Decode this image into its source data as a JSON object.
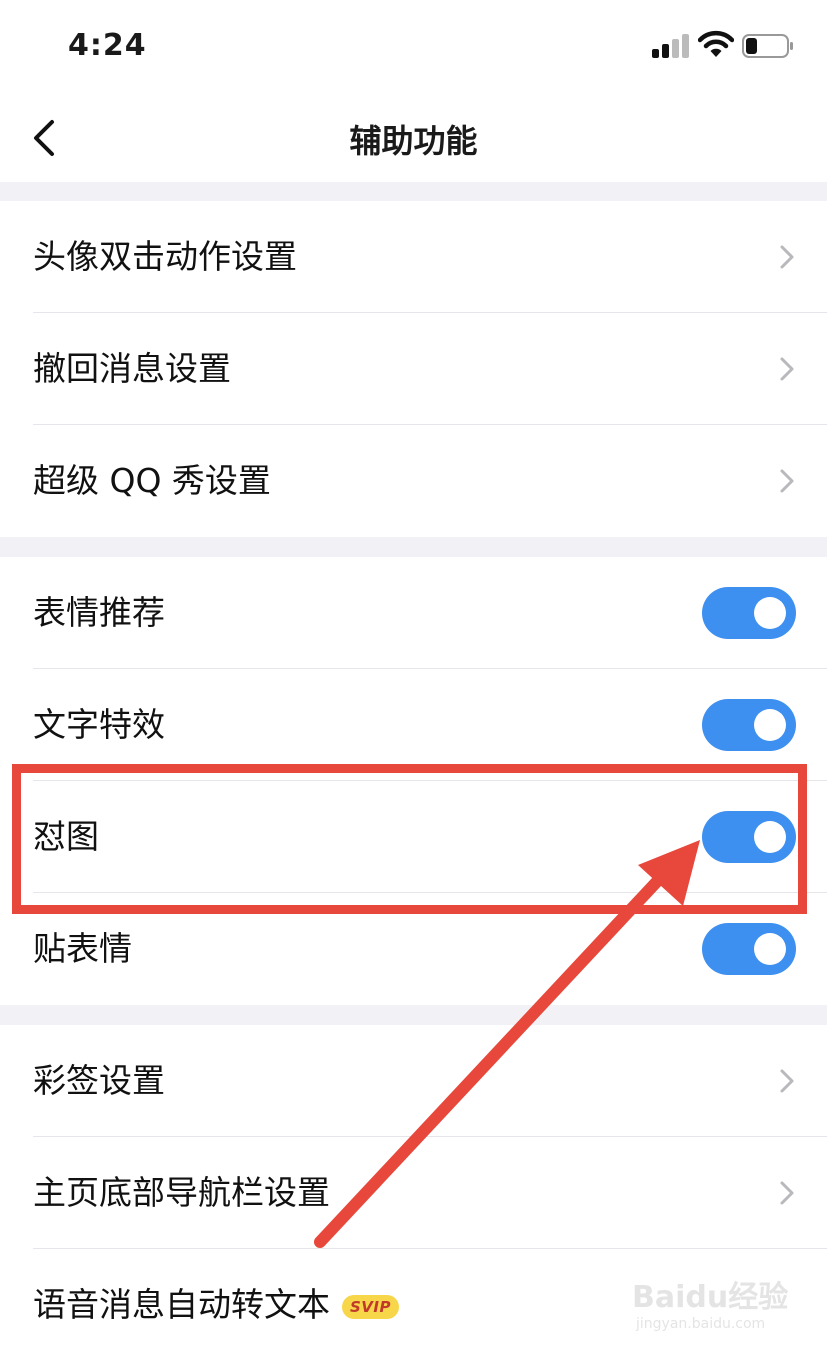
{
  "status_bar": {
    "time": "4:24"
  },
  "nav": {
    "title": "辅助功能"
  },
  "group1": [
    {
      "label": "头像双击动作设置"
    },
    {
      "label": "撤回消息设置"
    },
    {
      "label": "超级 QQ 秀设置"
    }
  ],
  "group2": [
    {
      "label": "表情推荐",
      "enabled": true
    },
    {
      "label": "文字特效",
      "enabled": true
    },
    {
      "label": "怼图",
      "enabled": true
    },
    {
      "label": "贴表情",
      "enabled": true
    }
  ],
  "group3": [
    {
      "label": "彩签设置"
    },
    {
      "label": "主页底部导航栏设置"
    },
    {
      "label": "语音消息自动转文本",
      "badge": "SVIP"
    }
  ],
  "watermark": {
    "logo": "Baidu经验",
    "url": "jingyan.baidu.com"
  },
  "colors": {
    "toggle_on": "#3d8ff0",
    "annotation": "#e7483b",
    "background_gap": "#f2f2f6",
    "badge": "#f7d64a"
  },
  "icons": [
    "cellular-signal-icon",
    "wifi-icon",
    "battery-icon",
    "back-chevron-icon",
    "chevron-right-icon"
  ]
}
